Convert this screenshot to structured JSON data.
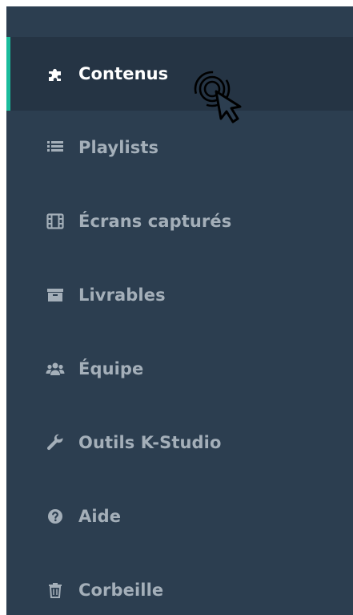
{
  "sidebar": {
    "items": [
      {
        "label": "Contenus",
        "icon": "puzzle-icon",
        "active": true
      },
      {
        "label": "Playlists",
        "icon": "list-icon",
        "active": false
      },
      {
        "label": "Écrans capturés",
        "icon": "film-icon",
        "active": false
      },
      {
        "label": "Livrables",
        "icon": "archive-icon",
        "active": false
      },
      {
        "label": "Équipe",
        "icon": "users-icon",
        "active": false
      },
      {
        "label": "Outils K-Studio",
        "icon": "wrench-icon",
        "active": false
      },
      {
        "label": "Aide",
        "icon": "question-icon",
        "active": false
      },
      {
        "label": "Corbeille",
        "icon": "trash-icon",
        "active": false
      }
    ]
  },
  "colors": {
    "sidebar_bg": "#2c3e50",
    "active_bg": "#253444",
    "accent": "#1abc9c",
    "text": "#a4afb9",
    "active_text": "#ffffff"
  }
}
